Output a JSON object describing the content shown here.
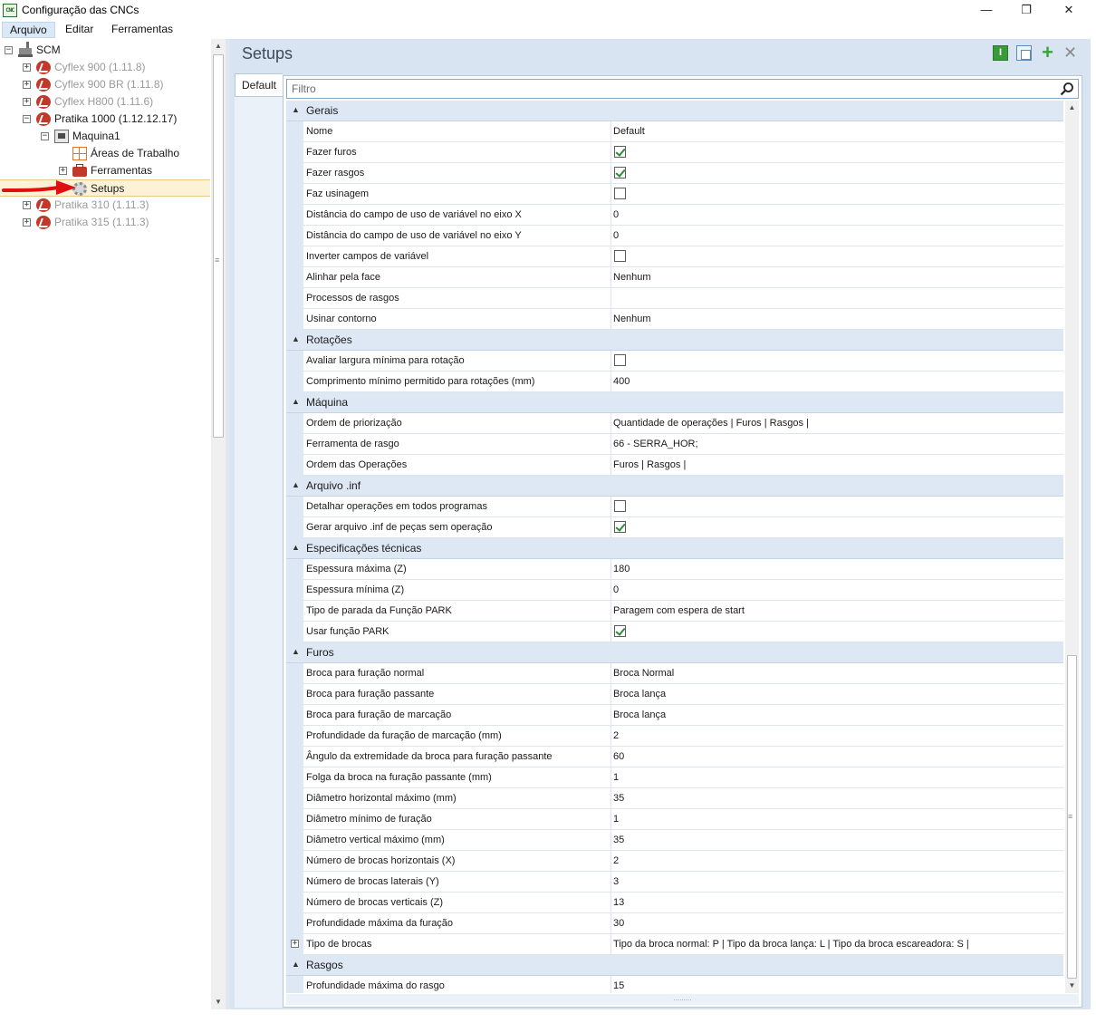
{
  "window": {
    "title": "Configuração das CNCs",
    "icon_text": "CNC",
    "minimize": "—",
    "maximize": "❐",
    "close": "✕"
  },
  "menu": [
    {
      "label": "Arquivo",
      "active": true
    },
    {
      "label": "Editar",
      "active": false
    },
    {
      "label": "Ferramentas",
      "active": false
    }
  ],
  "tree": [
    {
      "level": 0,
      "expander": "−",
      "icon": "factory-icon",
      "label": "SCM",
      "disabled": false
    },
    {
      "level": 1,
      "expander": "+",
      "icon": "cnc-logo-icon",
      "label": "Cyflex 900 (1.11.8)",
      "disabled": true
    },
    {
      "level": 1,
      "expander": "+",
      "icon": "cnc-logo-icon",
      "label": "Cyflex 900 BR (1.11.8)",
      "disabled": true
    },
    {
      "level": 1,
      "expander": "+",
      "icon": "cnc-logo-icon",
      "label": "Cyflex H800 (1.11.6)",
      "disabled": true
    },
    {
      "level": 1,
      "expander": "−",
      "icon": "cnc-logo-icon",
      "label": "Pratika 1000 (1.12.12.17)",
      "disabled": false
    },
    {
      "level": 2,
      "expander": "−",
      "icon": "machine-icon",
      "label": "Maquina1",
      "disabled": false
    },
    {
      "level": 3,
      "expander": "",
      "icon": "work-areas-icon",
      "label": "Áreas de Trabalho",
      "disabled": false
    },
    {
      "level": 3,
      "expander": "+",
      "icon": "toolbox-icon",
      "label": "Ferramentas",
      "disabled": false
    },
    {
      "level": 3,
      "expander": "",
      "icon": "gear-icon",
      "label": "Setups",
      "disabled": false,
      "selected": true
    },
    {
      "level": 1,
      "expander": "+",
      "icon": "cnc-logo-icon",
      "label": "Pratika 310 (1.11.3)",
      "disabled": true
    },
    {
      "level": 1,
      "expander": "+",
      "icon": "cnc-logo-icon",
      "label": "Pratika 315 (1.11.3)",
      "disabled": true
    }
  ],
  "panel": {
    "title": "Setups",
    "tab": "Default",
    "filter_placeholder": "Filtro",
    "info_label": "I",
    "add_label": "+",
    "delete_label": "✕"
  },
  "grid": [
    {
      "type": "category",
      "label": "Gerais"
    },
    {
      "type": "prop",
      "name": "Nome",
      "value": "Default"
    },
    {
      "type": "prop",
      "name": "Fazer furos",
      "check": true
    },
    {
      "type": "prop",
      "name": "Fazer rasgos",
      "check": true
    },
    {
      "type": "prop",
      "name": "Faz usinagem",
      "check": false
    },
    {
      "type": "prop",
      "name": "Distância do campo de uso de variável no eixo X",
      "value": "0"
    },
    {
      "type": "prop",
      "name": "Distância do campo de uso de variável no eixo Y",
      "value": "0"
    },
    {
      "type": "prop",
      "name": "Inverter campos de variável",
      "check": false
    },
    {
      "type": "prop",
      "name": "Alinhar pela face",
      "value": "Nenhum"
    },
    {
      "type": "prop",
      "name": "Processos de rasgos",
      "value": ""
    },
    {
      "type": "prop",
      "name": "Usinar contorno",
      "value": "Nenhum"
    },
    {
      "type": "category",
      "label": "Rotações"
    },
    {
      "type": "prop",
      "name": "Avaliar largura mínima para rotação",
      "check": false
    },
    {
      "type": "prop",
      "name": "Comprimento mínimo permitido para rotações (mm)",
      "value": "400"
    },
    {
      "type": "category",
      "label": "Máquina"
    },
    {
      "type": "prop",
      "name": "Ordem de priorização",
      "value": "Quantidade de operações | Furos | Rasgos |"
    },
    {
      "type": "prop",
      "name": "Ferramenta de rasgo",
      "value": "66 - SERRA_HOR;"
    },
    {
      "type": "prop",
      "name": "Ordem das Operações",
      "value": "Furos | Rasgos |"
    },
    {
      "type": "category",
      "label": "Arquivo .inf"
    },
    {
      "type": "prop",
      "name": "Detalhar operações em todos programas",
      "check": false
    },
    {
      "type": "prop",
      "name": "Gerar arquivo .inf de peças sem operação",
      "check": true
    },
    {
      "type": "category",
      "label": "Especificações técnicas"
    },
    {
      "type": "prop",
      "name": "Espessura máxima (Z)",
      "value": "180"
    },
    {
      "type": "prop",
      "name": "Espessura mínima (Z)",
      "value": "0"
    },
    {
      "type": "prop",
      "name": "Tipo de parada da Função PARK",
      "value": "Paragem com espera de start"
    },
    {
      "type": "prop",
      "name": "Usar função PARK",
      "check": true
    },
    {
      "type": "category",
      "label": "Furos"
    },
    {
      "type": "prop",
      "name": "Broca para furação normal",
      "value": "Broca Normal"
    },
    {
      "type": "prop",
      "name": "Broca para furação passante",
      "value": "Broca lança"
    },
    {
      "type": "prop",
      "name": "Broca para furação de marcação",
      "value": "Broca lança"
    },
    {
      "type": "prop",
      "name": "Profundidade da furação de marcação (mm)",
      "value": "2"
    },
    {
      "type": "prop",
      "name": "Ângulo da extremidade da broca para furação passante",
      "value": "60"
    },
    {
      "type": "prop",
      "name": "Folga da broca na furação passante (mm)",
      "value": "1"
    },
    {
      "type": "prop",
      "name": "Diâmetro horizontal máximo (mm)",
      "value": "35"
    },
    {
      "type": "prop",
      "name": "Diâmetro mínimo de furação",
      "value": "1"
    },
    {
      "type": "prop",
      "name": "Diâmetro vertical máximo (mm)",
      "value": "35"
    },
    {
      "type": "prop",
      "name": "Número de brocas horizontais (X)",
      "value": "2"
    },
    {
      "type": "prop",
      "name": "Número de brocas laterais (Y)",
      "value": "3"
    },
    {
      "type": "prop",
      "name": "Número de brocas verticais (Z)",
      "value": "13"
    },
    {
      "type": "prop",
      "name": "Profundidade máxima da furação",
      "value": "30"
    },
    {
      "type": "prop",
      "name": "Tipo de brocas",
      "value": "Tipo da broca normal: P  |  Tipo da broca lança: L  |  Tipo da broca escareadora: S  |",
      "expandable": true
    },
    {
      "type": "category",
      "label": "Rasgos"
    },
    {
      "type": "prop",
      "name": "Profundidade máxima do rasgo",
      "value": "15"
    }
  ]
}
